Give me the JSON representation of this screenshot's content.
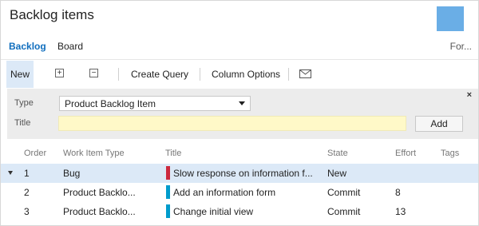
{
  "colors": {
    "accent": "#6aaee6",
    "link": "#106ebe",
    "selected_bg": "#dce9f7",
    "bug": "#cc293d",
    "pbi": "#009ccc",
    "title_input_bg": "#fff9c8"
  },
  "header": {
    "title": "Backlog items"
  },
  "tabs": [
    {
      "label": "Backlog",
      "active": true
    },
    {
      "label": "Board",
      "active": false
    },
    {
      "label": "For...",
      "active": false
    }
  ],
  "toolbar": {
    "new_label": "New",
    "expand_icon": "expand-all-icon",
    "collapse_icon": "collapse-all-icon",
    "create_query_label": "Create Query",
    "column_options_label": "Column Options",
    "mail_icon": "envelope-icon"
  },
  "new_item_panel": {
    "close_glyph": "×",
    "type_label": "Type",
    "type_value": "Product Backlog Item",
    "title_label": "Title",
    "title_value": "",
    "add_label": "Add"
  },
  "grid": {
    "columns": [
      "Order",
      "Work Item Type",
      "Title",
      "State",
      "Effort",
      "Tags"
    ],
    "rows": [
      {
        "order": "1",
        "type": "Bug",
        "type_color": "bug",
        "title": "Slow response on information f...",
        "state": "New",
        "effort": "",
        "tags": "",
        "selected": true
      },
      {
        "order": "2",
        "type": "Product Backlo...",
        "type_color": "pbi",
        "title": "Add an information form",
        "state": "Commit",
        "effort": "8",
        "tags": "",
        "selected": false
      },
      {
        "order": "3",
        "type": "Product Backlo...",
        "type_color": "pbi",
        "title": "Change initial view",
        "state": "Commit",
        "effort": "13",
        "tags": "",
        "selected": false
      }
    ]
  }
}
